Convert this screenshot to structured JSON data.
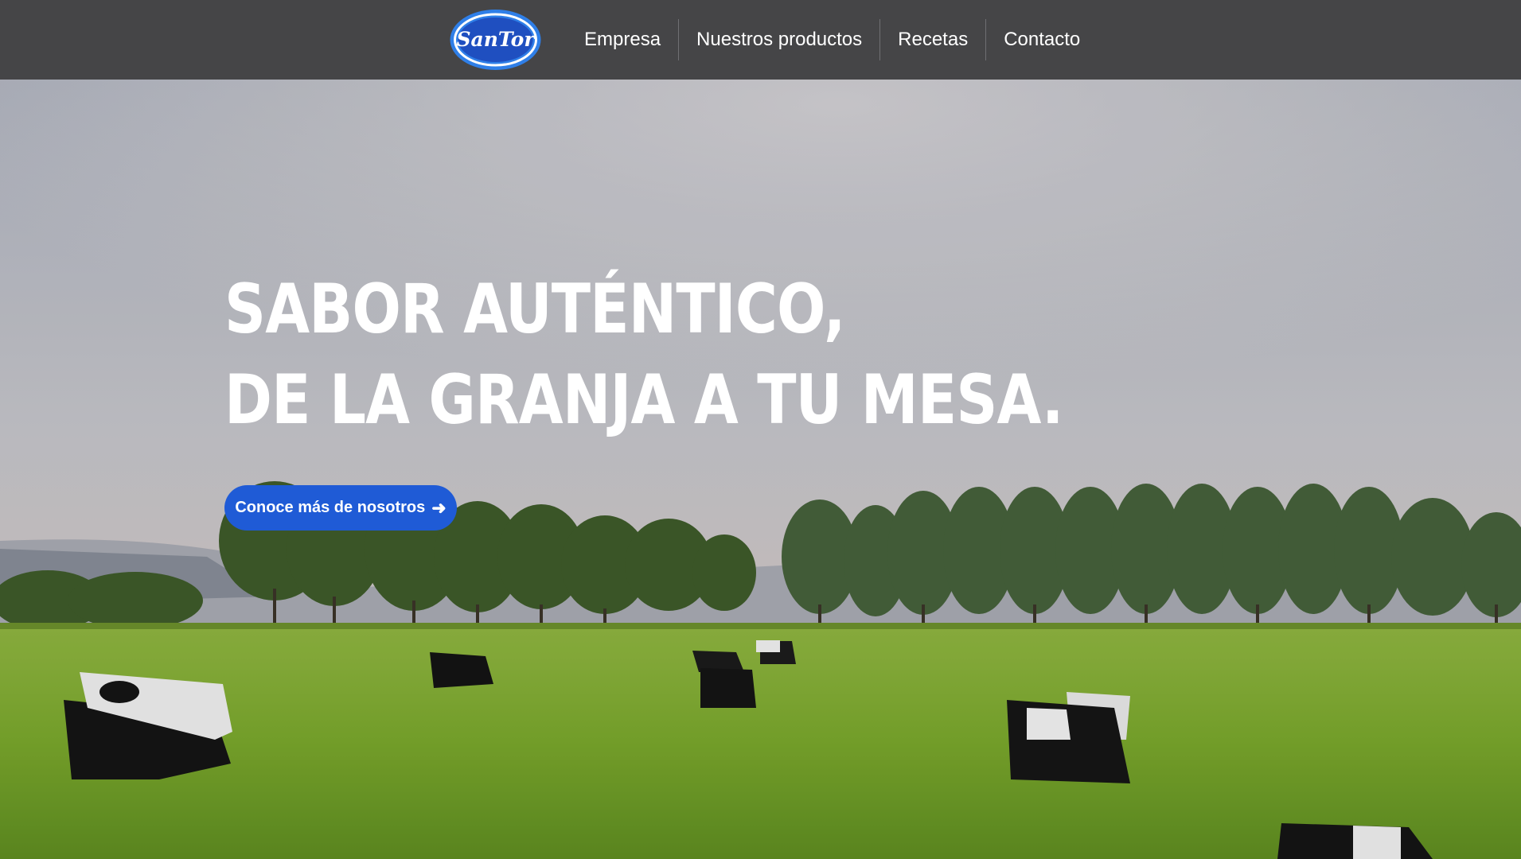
{
  "brand": {
    "logo_text": "SanTor",
    "logo_color": "#2f7fe8"
  },
  "nav": {
    "items": [
      {
        "label": "Empresa"
      },
      {
        "label": "Nuestros productos"
      },
      {
        "label": "Recetas"
      },
      {
        "label": "Contacto"
      }
    ]
  },
  "hero": {
    "headline_line1": "SABOR AUTÉNTICO,",
    "headline_line2": "DE LA GRANJA A TU MESA.",
    "cta_label": "Conoce más de nosotros",
    "cta_icon": "arrow-right-icon",
    "cta_arrow": "➜",
    "cta_color": "#1f5bd6",
    "background": "cows-grazing-in-green-pasture-photo"
  },
  "colors": {
    "topbar": "#454547",
    "grass": "#7dab2f",
    "sky": "#b9bcc5"
  }
}
